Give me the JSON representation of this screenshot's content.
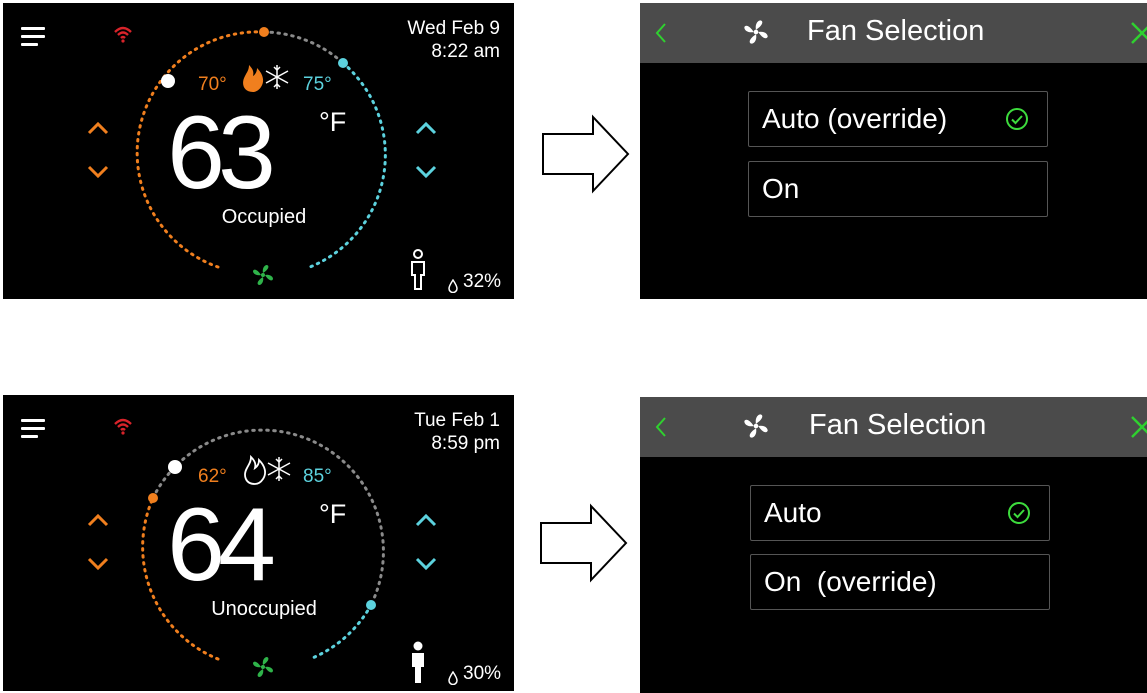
{
  "screens": [
    {
      "thermostat": {
        "date": "Wed Feb 9",
        "time": "8:22 am",
        "heat_setpoint": "70°",
        "cool_setpoint": "75°",
        "temperature": "63",
        "unit": "°F",
        "status": "Occupied",
        "humidity": "32%",
        "mode_icon": "heat-cool-icon",
        "occupancy_icon": "person-outline-icon"
      },
      "fan_panel": {
        "title": "Fan Selection",
        "options": [
          {
            "label": "Auto (override)",
            "selected": true
          },
          {
            "label": "On",
            "selected": false
          }
        ]
      }
    },
    {
      "thermostat": {
        "date": "Tue Feb 1",
        "time": "8:59 pm",
        "heat_setpoint": "62°",
        "cool_setpoint": "85°",
        "temperature": "64",
        "unit": "°F",
        "status": "Unoccupied",
        "humidity": "30%",
        "mode_icon": "heat-cool-outline-icon",
        "occupancy_icon": "person-filled-icon"
      },
      "fan_panel": {
        "title": "Fan Selection",
        "options": [
          {
            "label": "Auto",
            "selected": true
          },
          {
            "label": "On  (override)",
            "selected": false
          }
        ]
      }
    }
  ],
  "colors": {
    "heat": "#f07f1e",
    "cool": "#5cd2de",
    "fan": "#2fb34a",
    "wifi": "#d8232a",
    "check": "#3ddc3d",
    "header": "#4b4b4b"
  }
}
